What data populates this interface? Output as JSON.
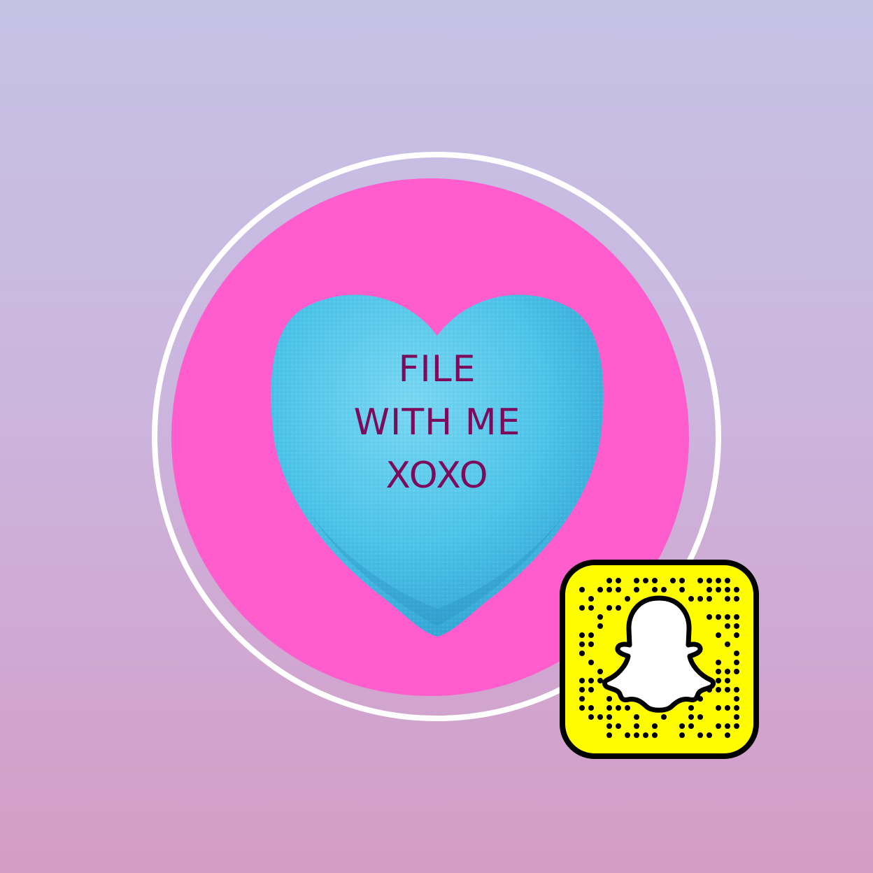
{
  "heart_message": {
    "line1": "FILE",
    "line2": "WITH ME",
    "line3": "XOXO"
  },
  "colors": {
    "background_top": "#c5c2e6",
    "background_bottom": "#d49cc6",
    "pink_disc": "#ff5ccd",
    "ring": "#ffffff",
    "heart": "#4cc3e8",
    "heart_text": "#7c0b5c",
    "snapcode_yellow": "#fffc00"
  },
  "icons": {
    "snapcode": "snapcode-icon",
    "ghost": "ghost-icon"
  }
}
